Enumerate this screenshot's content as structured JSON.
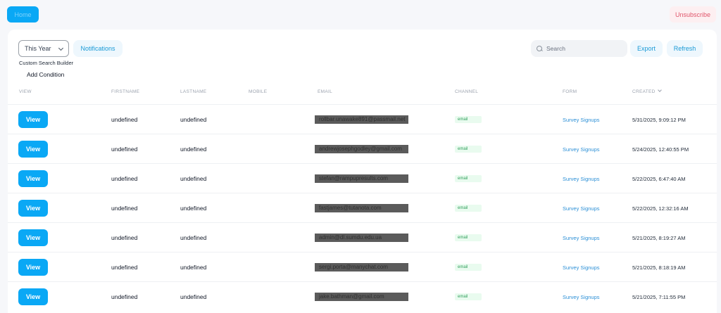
{
  "header": {
    "home_label": "Home",
    "unsubscribe_label": "Unsubscribe"
  },
  "toolbar": {
    "period_value": "This Year",
    "notifications_label": "Notifications",
    "custom_search_label": "Custom Search Builder",
    "add_condition_label": "Add Condition",
    "search_placeholder": "Search",
    "export_label": "Export",
    "refresh_label": "Refresh"
  },
  "table": {
    "columns": [
      "VIEW",
      "FIRSTNAME",
      "LASTNAME",
      "MOBILE",
      "EMAIL",
      "CHANNEL",
      "FORM",
      "CREATED"
    ],
    "view_label": "View",
    "rows": [
      {
        "firstname": "undefined",
        "lastname": "undefined",
        "mobile": "",
        "email": "rollbar.unawake891@passmail.net",
        "channel": "email",
        "form": "Survey Signups",
        "created": "5/31/2025, 9:09:12 PM"
      },
      {
        "firstname": "undefined",
        "lastname": "undefined",
        "mobile": "",
        "email": "andrewjosephgodley@gmail.com",
        "channel": "email",
        "form": "Survey Signups",
        "created": "5/24/2025, 12:40:55 PM"
      },
      {
        "firstname": "undefined",
        "lastname": "undefined",
        "mobile": "",
        "email": "stefan@rampupresults.com",
        "channel": "email",
        "form": "Survey Signups",
        "created": "5/22/2025, 6:47:40 AM"
      },
      {
        "firstname": "undefined",
        "lastname": "undefined",
        "mobile": "",
        "email": "fastjames@tutanota.com",
        "channel": "email",
        "form": "Survey Signups",
        "created": "5/22/2025, 12:32:16 AM"
      },
      {
        "firstname": "undefined",
        "lastname": "undefined",
        "mobile": "",
        "email": "admin@dl.sumdu.edu.ua",
        "channel": "email",
        "form": "Survey Signups",
        "created": "5/21/2025, 8:19:27 AM"
      },
      {
        "firstname": "undefined",
        "lastname": "undefined",
        "mobile": "",
        "email": "sergi.porta@manychat.com",
        "channel": "email",
        "form": "Survey Signups",
        "created": "5/21/2025, 8:18:19 AM"
      },
      {
        "firstname": "undefined",
        "lastname": "undefined",
        "mobile": "",
        "email": "jake.bathman@gmail.com",
        "channel": "email",
        "form": "Survey Signups",
        "created": "5/21/2025, 7:11:55 PM"
      }
    ]
  },
  "colors": {
    "primary": "#0aa8f5",
    "accent_link": "#2b8fd6",
    "danger": "#e0556b",
    "success": "#2f9e5a"
  },
  "icons": {
    "search": "search-icon",
    "dropdown": "chevron-down-icon",
    "sort": "sort-desc-icon"
  }
}
